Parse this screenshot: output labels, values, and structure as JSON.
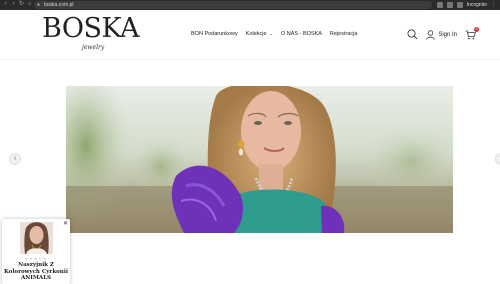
{
  "browser": {
    "url": "boska.com.pl",
    "profile_label": "Incognito"
  },
  "header": {
    "logo_main": "BOSKA",
    "logo_script": "jewelry",
    "nav": [
      {
        "label": "BON Podarunkowy"
      },
      {
        "label": "Kolekcje"
      },
      {
        "label": "O NAS - BOSKA"
      },
      {
        "label": "Rejestracja"
      }
    ],
    "signin_label": "Sign In",
    "cart_count": "0"
  },
  "hero": {
    "image": "model-portrait-purple-feather"
  },
  "popup": {
    "product_title": "Naszyjnik Z Kolorowych Cyrkonii ANIMALS",
    "stars_filled": 0,
    "stars_total": 5
  },
  "colors": {
    "accent_badge": "#d2302a",
    "chrome_bar": "#2b2b2b"
  }
}
